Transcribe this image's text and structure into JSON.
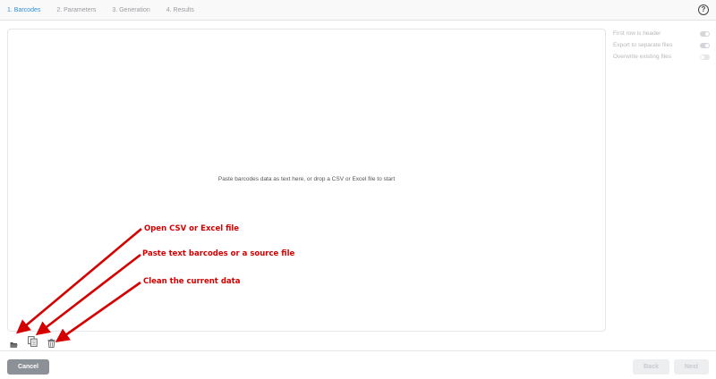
{
  "steps": [
    {
      "label": "1. Barcodes",
      "active": true
    },
    {
      "label": "2. Parameters",
      "active": false
    },
    {
      "label": "3. Generation",
      "active": false
    },
    {
      "label": "4. Results",
      "active": false
    }
  ],
  "help_label": "?",
  "editor": {
    "hint": "Paste barcodes data as text here, or drop a CSV or Excel file to start"
  },
  "options": [
    {
      "label": "First row is header",
      "state": "on"
    },
    {
      "label": "Export to separate files",
      "state": "on"
    },
    {
      "label": "Overwrite existing files",
      "state": "off"
    }
  ],
  "toolbar": {
    "open_icon": "folder-open-icon",
    "paste_icon": "paste-icon",
    "clean_icon": "trash-icon"
  },
  "annotations": {
    "open": "Open CSV or Excel file",
    "paste": "Paste text barcodes or a source file",
    "clean": "Clean the current data",
    "color": "#d40000"
  },
  "footer": {
    "cancel": "Cancel",
    "back": "Back",
    "next": "Next"
  },
  "colors": {
    "active_step": "#2f8fd8",
    "cancel_button": "#8c9097"
  }
}
